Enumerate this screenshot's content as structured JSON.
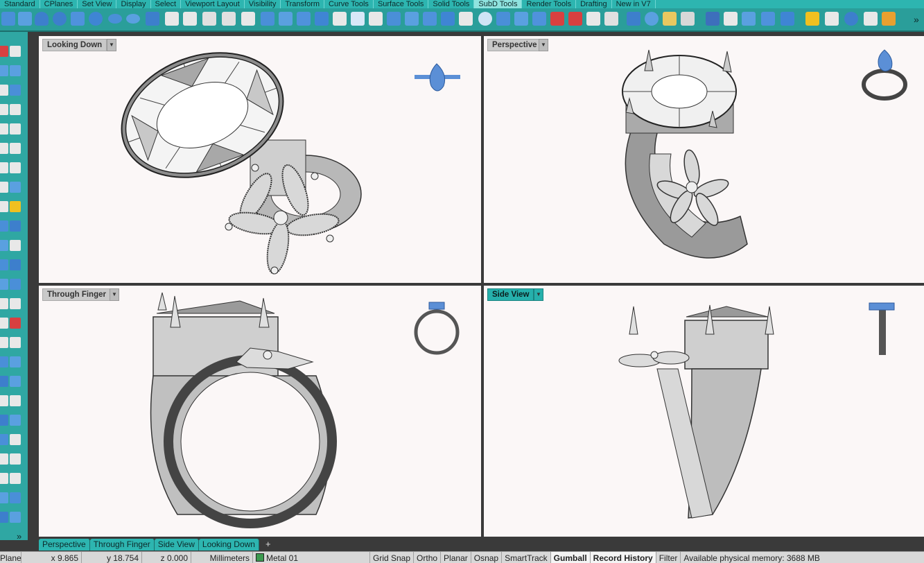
{
  "ribbon_tabs": [
    "Standard",
    "CPlanes",
    "Set View",
    "Display",
    "Select",
    "Viewport Layout",
    "Visibility",
    "Transform",
    "Curve Tools",
    "Surface Tools",
    "Solid Tools",
    "SubD Tools",
    "Render Tools",
    "Drafting",
    "New in V7"
  ],
  "selected_ribbon_tab": "SubD Tools",
  "viewports": {
    "top_left": {
      "label": "Looking Down"
    },
    "top_right": {
      "label": "Perspective"
    },
    "bottom_left": {
      "label": "Through Finger"
    },
    "bottom_right": {
      "label": "Side View"
    }
  },
  "viewport_tabs": [
    "Perspective",
    "Through Finger",
    "Side View",
    "Looking Down"
  ],
  "add_tab_symbol": "+",
  "status": {
    "cplane": "Plane",
    "x": "x 9.865",
    "y": "y 18.754",
    "z": "z 0.000",
    "units": "Millimeters",
    "layer": "Metal 01",
    "toggles": [
      "Grid Snap",
      "Ortho",
      "Planar",
      "Osnap",
      "SmartTrack",
      "Gumball",
      "Record History",
      "Filter"
    ],
    "active_toggles": [
      "Gumball",
      "Record History"
    ],
    "memory": "Available physical memory: 3688 MB"
  },
  "colors": {
    "accent": "#2db5b0",
    "viewport_bg": "#fbf7f7",
    "gem_blue": "#5b8fd6"
  },
  "overflow_glyph": "»"
}
